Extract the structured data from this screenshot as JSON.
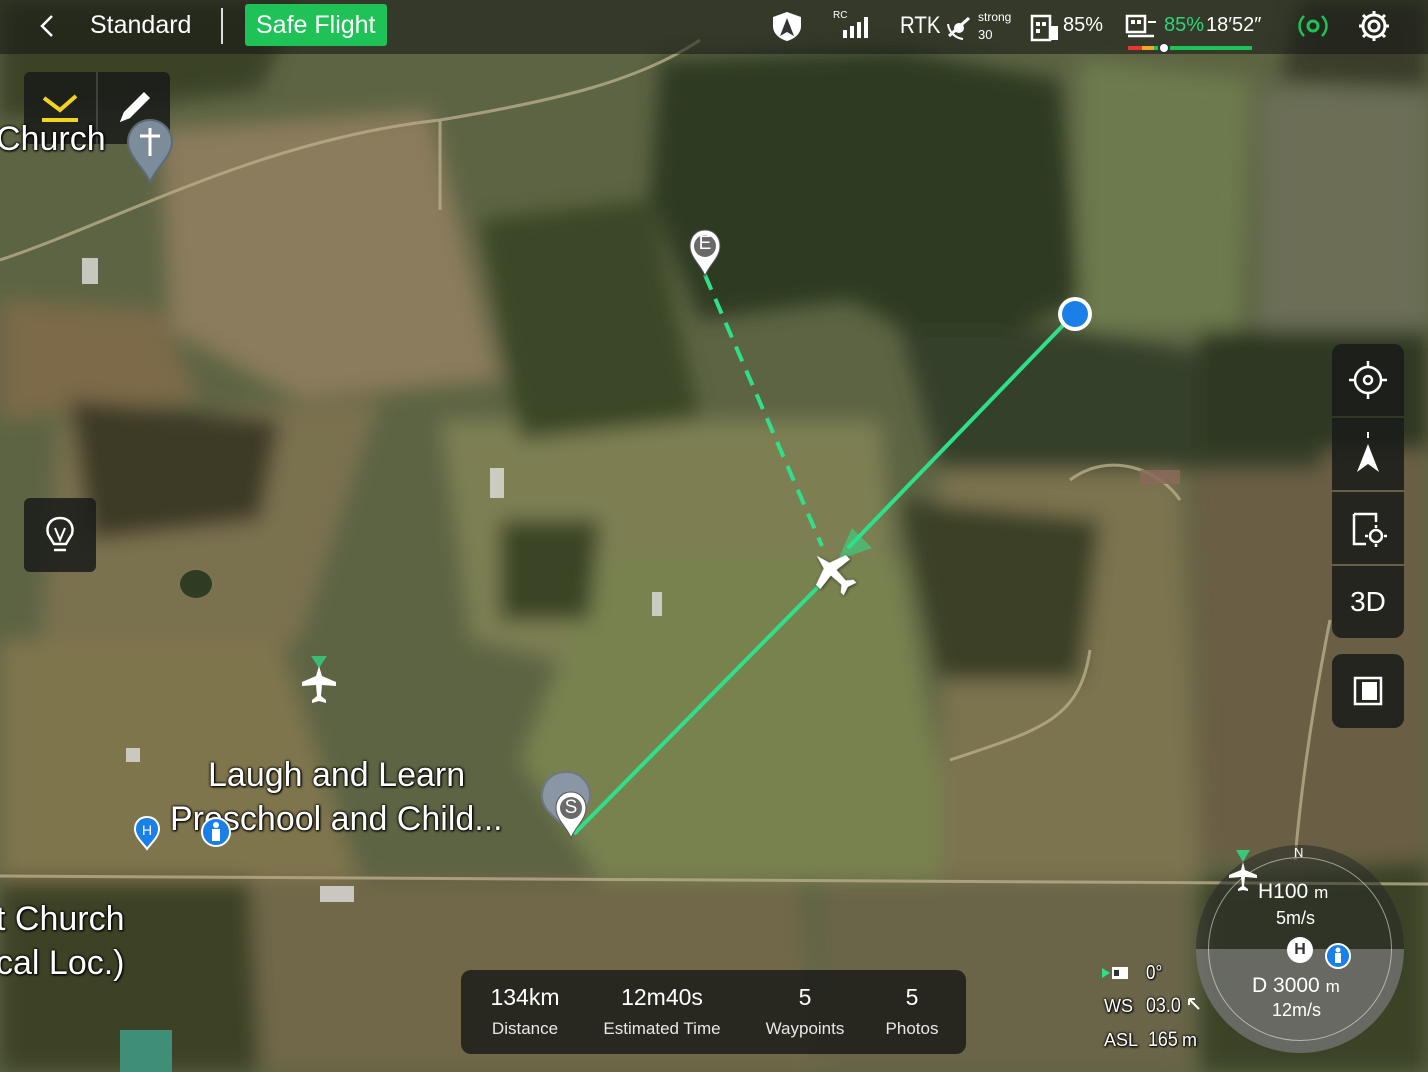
{
  "topbar": {
    "back_icon": "chevron-left-icon",
    "mode": "Standard",
    "safe_flight": "Safe Flight",
    "rc_label": "RC",
    "rtk_label": "RTK",
    "gnss_strength": "strong",
    "gnss_count": "30",
    "ac_battery": "85%",
    "rc_battery": "85%",
    "flight_time": "18′52″",
    "colors": {
      "safe": "#1fc257",
      "accent_green": "#1fc257"
    }
  },
  "map": {
    "labels": {
      "church_top": "Church",
      "preschool_line1": "Laugh and Learn",
      "preschool_line2": "Preschool and Child...",
      "church_bottom_line1": "t Church",
      "church_bottom_line2": "cal Loc.)"
    },
    "markers": {
      "end": "E",
      "start": "S"
    },
    "colors": {
      "route": "#2ee08a",
      "marker_blue": "#1a7fe8"
    }
  },
  "right_toolbar": {
    "locate_icon": "target-icon",
    "north_icon": "north-arrow-icon",
    "layers_icon": "map-settings-icon",
    "three_d": "3D",
    "split_icon": "split-view-icon"
  },
  "stats": {
    "distance_value": "134km",
    "distance_label": "Distance",
    "time_value": "12m40s",
    "time_label": "Estimated Time",
    "waypoints_value": "5",
    "waypoints_label": "Waypoints",
    "photos_value": "5",
    "photos_label": "Photos"
  },
  "telemetry": {
    "gimbal_angle": "0°",
    "ws_label": "WS",
    "ws_value": "03.0",
    "asl_label": "ASL",
    "asl_value": "165",
    "asl_unit": "m"
  },
  "compass": {
    "north": "N",
    "h_label": "H",
    "h_value": "100",
    "h_unit": "m",
    "h_speed": "5m/s",
    "d_label": "D",
    "d_value": "3000",
    "d_unit": "m",
    "d_speed": "12m/s",
    "home_marker": "H"
  }
}
